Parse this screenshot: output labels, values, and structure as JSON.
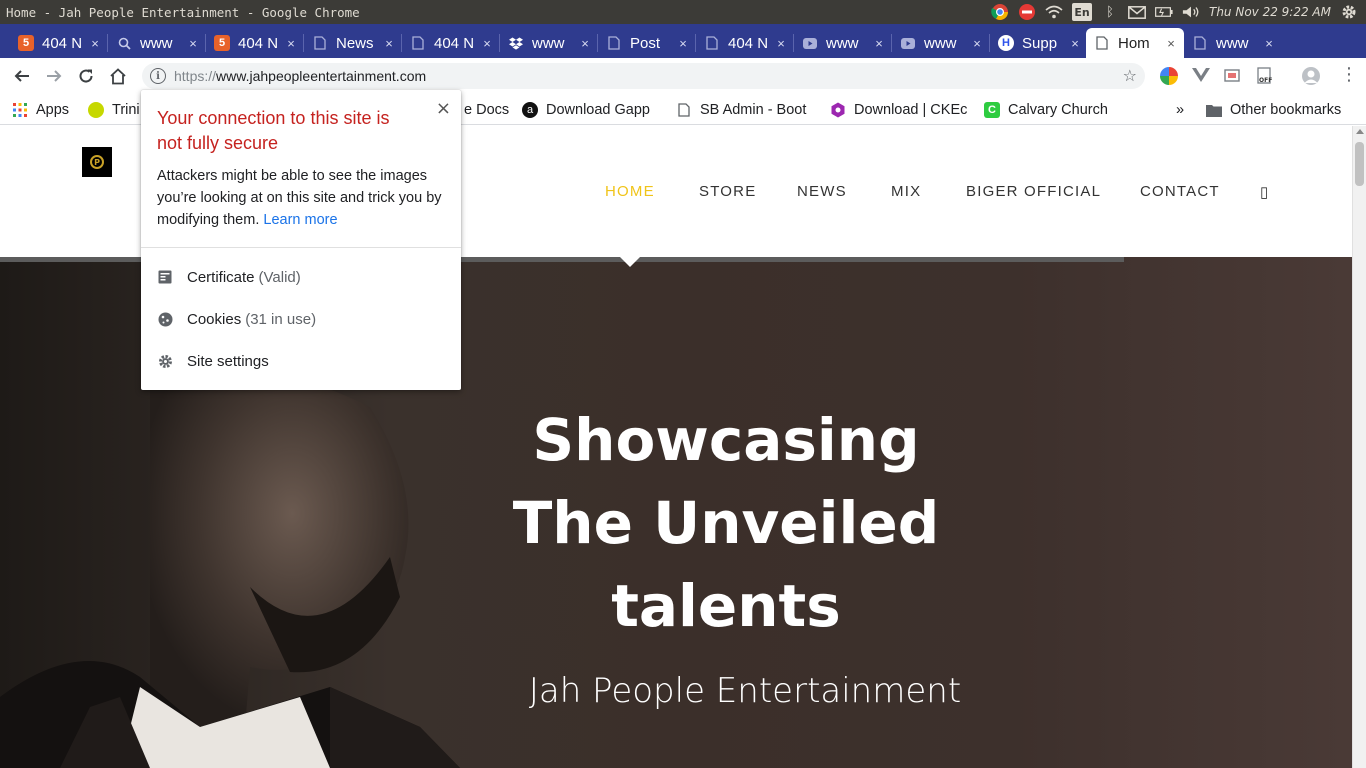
{
  "os": {
    "window_title": "Home - Jah People Entertainment - Google Chrome",
    "language": "En",
    "clock": "Thu Nov 22  9:22 AM"
  },
  "tabs": [
    {
      "label": "404 N",
      "favicon": "html5-icon",
      "color": "#e8622a"
    },
    {
      "label": "www",
      "favicon": "search-icon",
      "color": "#aab0d9"
    },
    {
      "label": "404 N",
      "favicon": "html5-icon",
      "color": "#e8622a"
    },
    {
      "label": "News",
      "favicon": "page-icon",
      "color": "#aab0d9"
    },
    {
      "label": "404 N",
      "favicon": "page-icon",
      "color": "#aab0d9"
    },
    {
      "label": "www",
      "favicon": "dropbox-icon",
      "color": "#ffffff"
    },
    {
      "label": "Post",
      "favicon": "page-icon",
      "color": "#aab0d9"
    },
    {
      "label": "404 N",
      "favicon": "page-icon",
      "color": "#aab0d9"
    },
    {
      "label": "www",
      "favicon": "youtube-icon",
      "color": "#aab0d9"
    },
    {
      "label": "www",
      "favicon": "youtube-icon",
      "color": "#aab0d9"
    },
    {
      "label": "Supp",
      "favicon": "hostinger-icon",
      "color": "#2f54eb"
    },
    {
      "label": "Hom",
      "favicon": "page-icon",
      "color": "#5f6368",
      "active": true
    },
    {
      "label": "www",
      "favicon": "page-icon",
      "color": "#aab0d9"
    }
  ],
  "toolbar": {
    "url_scheme": "https://",
    "url_host": "www.jahpeopleentertainment.com"
  },
  "bookmarks": {
    "apps": "Apps",
    "trinity": "Trini",
    "docs": "e Docs",
    "gapp": "Download Gapp",
    "sbadmin": "SB Admin - Boot",
    "ckeditor": "Download | CKEc",
    "calvary": "Calvary Church",
    "more": "»",
    "other": "Other bookmarks"
  },
  "site": {
    "nav": [
      "HOME",
      "STORE",
      "NEWS",
      "MIX",
      "BIGER OFFICIAL",
      "CONTACT"
    ],
    "search_glyph": "▯",
    "hero_line1": "Showcasing",
    "hero_line2": "The Unveiled",
    "hero_line3": "talents",
    "hero_subtitle": "Jah People Entertainment",
    "accent_color": "#f0c419"
  },
  "popup": {
    "close": "×",
    "heading": "Your connection to this site is not fully secure",
    "body": "Attackers might be able to see the images you’re looking at on this site and trick you by modifying them.",
    "link": "Learn more",
    "certificate_label": "Certificate",
    "certificate_status": "(Valid)",
    "cookies_label": "Cookies",
    "cookies_status": "(31 in use)",
    "site_settings": "Site settings"
  }
}
